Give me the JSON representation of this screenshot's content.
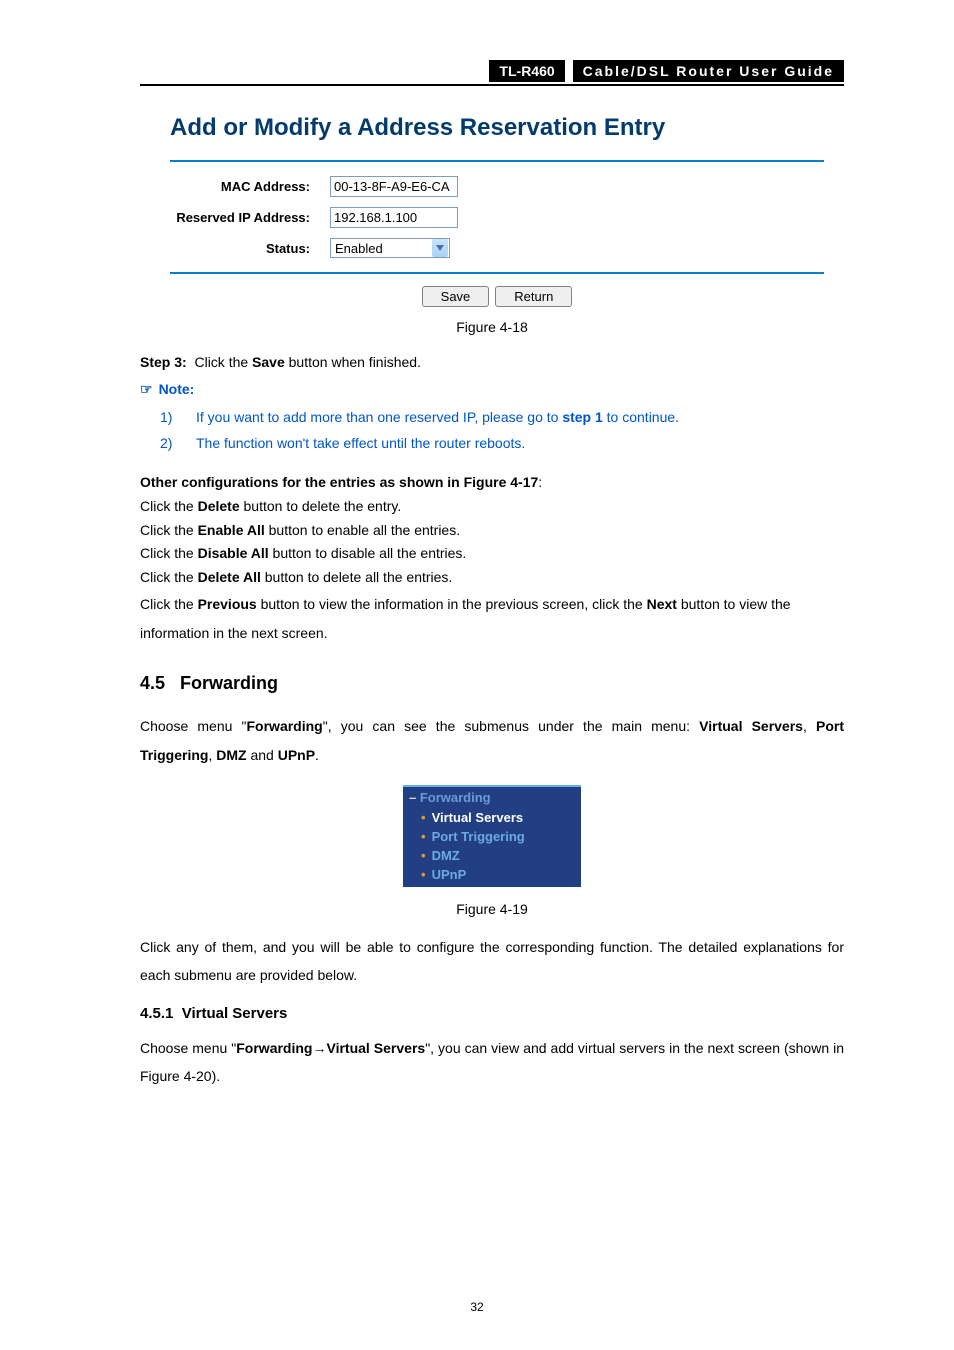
{
  "header": {
    "model": "TL-R460",
    "guide": "Cable/DSL  Router  User  Guide"
  },
  "dialog": {
    "title": "Add or Modify a Address Reservation Entry",
    "labels": {
      "mac": "MAC Address:",
      "ip": "Reserved IP Address:",
      "status": "Status:"
    },
    "values": {
      "mac": "00-13-8F-A9-E6-CA",
      "ip": "192.168.1.100",
      "status": "Enabled"
    },
    "buttons": {
      "save": "Save",
      "return": "Return"
    }
  },
  "captions": {
    "fig418": "Figure 4-18",
    "fig419": "Figure 4-19"
  },
  "step3": {
    "prefix": "Step 3:",
    "rest": "  Click the ",
    "bold": "Save",
    "end": " button when finished."
  },
  "note": {
    "label": "Note:",
    "item1_a": "If you want to add more than one reserved IP, please go to ",
    "item1_b": "step 1",
    "item1_c": " to continue.",
    "item2": "The function won't take effect until the router reboots."
  },
  "otherconfig": {
    "heading": "Other configurations for the entries as shown in Figure 4-17",
    "lines": {
      "l1a": "Click the ",
      "l1b": "Delete",
      "l1c": " button to delete the entry.",
      "l2a": "Click the ",
      "l2b": "Enable All",
      "l2c": " button to enable all the entries.",
      "l3a": "Click the ",
      "l3b": "Disable All",
      "l3c": " button to disable all the entries.",
      "l4a": "Click the ",
      "l4b": "Delete All",
      "l4c": " button to delete all the entries.",
      "l5a": "Click the ",
      "l5b": "Previous",
      "l5c": " button to view the information in the previous screen, click the ",
      "l5d": "Next",
      "l5e": " button to view the information in the next screen."
    }
  },
  "section": {
    "num": "4.5",
    "title": "Forwarding",
    "intro_a": "Choose menu \"",
    "intro_b": "Forwarding",
    "intro_c": "\", you can see the submenus under the main menu: ",
    "intro_d": "Virtual Servers",
    "intro_e": ", ",
    "intro_f": "Port Triggering",
    "intro_g": ", ",
    "intro_h": "DMZ",
    "intro_i": " and ",
    "intro_j": "UPnP",
    "intro_k": "."
  },
  "menu": {
    "header": "Forwarding",
    "items": [
      "Virtual Servers",
      "Port Triggering",
      "DMZ",
      "UPnP"
    ]
  },
  "after_menu": "Click any of them, and you will be able to configure the corresponding function. The detailed explanations for each submenu are provided below.",
  "subsection": {
    "num": "4.5.1",
    "title": "Virtual Servers",
    "text_a": "Choose menu \"",
    "text_b": "Forwarding",
    "text_arrow": "→",
    "text_c": "Virtual Servers",
    "text_d": "\", you can view and add virtual servers in the next screen (shown in Figure 4-20)."
  },
  "page_number": "32"
}
